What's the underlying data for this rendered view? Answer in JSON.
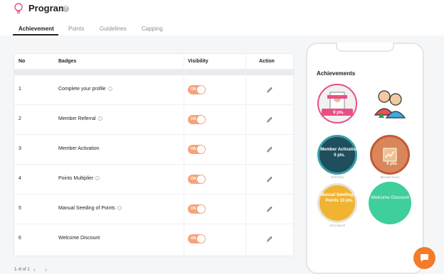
{
  "header": {
    "title": "Program",
    "help": "?"
  },
  "tabs": [
    {
      "label": "Achievement",
      "active": true
    },
    {
      "label": "Points",
      "active": false
    },
    {
      "label": "Guidelines",
      "active": false
    },
    {
      "label": "Capping",
      "active": false
    }
  ],
  "table": {
    "headers": {
      "no": "No",
      "badges": "Badges",
      "visibility": "Visibility",
      "action": "Action"
    },
    "rows": [
      {
        "no": "1",
        "badge": "Complete your profile",
        "info": true,
        "toggle": "ON"
      },
      {
        "no": "2",
        "badge": "Member Referral",
        "info": true,
        "toggle": "ON"
      },
      {
        "no": "3",
        "badge": "Member Activation",
        "info": false,
        "toggle": "ON"
      },
      {
        "no": "4",
        "badge": "Points Multiplier",
        "info": true,
        "toggle": "ON"
      },
      {
        "no": "5",
        "badge": "Manual Seeding of Points",
        "info": true,
        "toggle": "ON"
      },
      {
        "no": "6",
        "badge": "Welcome Discount",
        "info": false,
        "toggle": "ON"
      }
    ]
  },
  "pagination": {
    "range": "1–6 of 1",
    "prev": "‹",
    "next": "›"
  },
  "phone": {
    "title": "Achievements",
    "badges": [
      {
        "name": "badge-1",
        "text": "9 pts.",
        "caption": ""
      },
      {
        "name": "badge-2",
        "text": "",
        "caption": ""
      },
      {
        "name": "badge-3",
        "text": "Member Activation 0 pts.",
        "caption": "CERTIFIED"
      },
      {
        "name": "badge-4",
        "text": "0 pts.",
        "caption": "BRONZE SALES"
      },
      {
        "name": "badge-5",
        "text": "Manual Seeding of Points 10 pts.",
        "caption": "GOLD SALES"
      },
      {
        "name": "badge-6",
        "text": "Welcome Discount",
        "caption": ""
      }
    ]
  },
  "colors": {
    "toggle": "#f4a47d",
    "chat": "#f47b2a",
    "welcome": "#3fcf9a",
    "accent_pink": "#e84f87"
  }
}
